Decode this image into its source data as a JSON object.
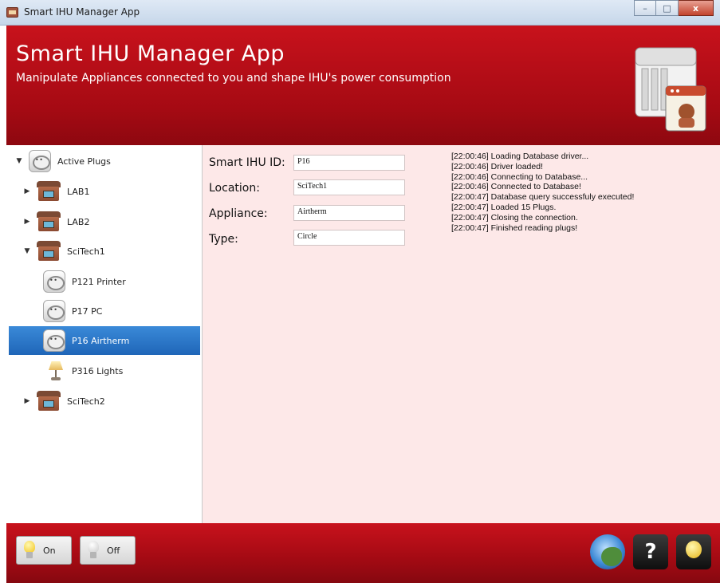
{
  "window": {
    "title": "Smart IHU Manager App",
    "controls": {
      "minimize": "–",
      "maximize": "□",
      "close": "x"
    }
  },
  "header": {
    "title": "Smart IHU Manager App",
    "subtitle": "Manipulate Appliances connected to you and shape IHU's power consumption"
  },
  "tree": {
    "items": [
      {
        "label": "Active Plugs",
        "icon": "plug-icon",
        "expanded": true
      },
      {
        "label": "LAB1",
        "icon": "building-icon",
        "expanded": false
      },
      {
        "label": "LAB2",
        "icon": "building-icon",
        "expanded": false
      },
      {
        "label": "SciTech1",
        "icon": "building-icon",
        "expanded": true
      },
      {
        "label": "P121 Printer",
        "icon": "plug-icon"
      },
      {
        "label": "P17 PC",
        "icon": "plug-icon"
      },
      {
        "label": "P16 Airtherm",
        "icon": "plug-icon",
        "selected": true
      },
      {
        "label": "P316 Lights",
        "icon": "lamp-icon"
      },
      {
        "label": "SciTech2",
        "icon": "building-icon",
        "expanded": false
      }
    ]
  },
  "details": {
    "smart_ihu_id": {
      "label": "Smart IHU ID:",
      "value": "P16"
    },
    "location": {
      "label": "Location:",
      "value": "SciTech1"
    },
    "appliance": {
      "label": "Appliance:",
      "value": "Airtherm"
    },
    "type": {
      "label": "Type:",
      "value": "Circle"
    }
  },
  "log": [
    "[22:00:46] Loading Database driver...",
    "[22:00:46] Driver loaded!",
    "[22:00:46] Connecting to Database...",
    "[22:00:46] Connected to Database!",
    "[22:00:47] Database query successfuly executed!",
    "[22:00:47] Loaded 15 Plugs.",
    "[22:00:47] Closing the connection.",
    "[22:00:47] Finished reading plugs!"
  ],
  "footer": {
    "on_label": "On",
    "off_label": "Off",
    "help_glyph": "?"
  },
  "colors": {
    "header_red": "#b40e17",
    "content_bg": "#fde8e8",
    "selection_blue": "#2a78c9"
  }
}
